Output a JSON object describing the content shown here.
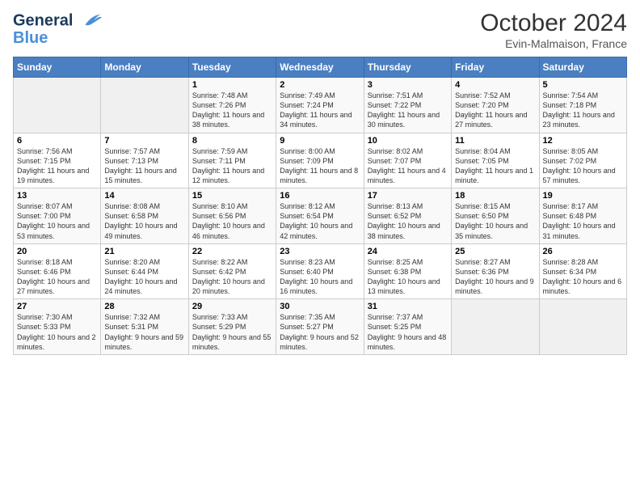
{
  "header": {
    "logo_line1": "General",
    "logo_line2": "Blue",
    "month": "October 2024",
    "location": "Evin-Malmaison, France"
  },
  "days_of_week": [
    "Sunday",
    "Monday",
    "Tuesday",
    "Wednesday",
    "Thursday",
    "Friday",
    "Saturday"
  ],
  "weeks": [
    [
      {
        "day": "",
        "info": ""
      },
      {
        "day": "",
        "info": ""
      },
      {
        "day": "1",
        "info": "Sunrise: 7:48 AM\nSunset: 7:26 PM\nDaylight: 11 hours and 38 minutes."
      },
      {
        "day": "2",
        "info": "Sunrise: 7:49 AM\nSunset: 7:24 PM\nDaylight: 11 hours and 34 minutes."
      },
      {
        "day": "3",
        "info": "Sunrise: 7:51 AM\nSunset: 7:22 PM\nDaylight: 11 hours and 30 minutes."
      },
      {
        "day": "4",
        "info": "Sunrise: 7:52 AM\nSunset: 7:20 PM\nDaylight: 11 hours and 27 minutes."
      },
      {
        "day": "5",
        "info": "Sunrise: 7:54 AM\nSunset: 7:18 PM\nDaylight: 11 hours and 23 minutes."
      }
    ],
    [
      {
        "day": "6",
        "info": "Sunrise: 7:56 AM\nSunset: 7:15 PM\nDaylight: 11 hours and 19 minutes."
      },
      {
        "day": "7",
        "info": "Sunrise: 7:57 AM\nSunset: 7:13 PM\nDaylight: 11 hours and 15 minutes."
      },
      {
        "day": "8",
        "info": "Sunrise: 7:59 AM\nSunset: 7:11 PM\nDaylight: 11 hours and 12 minutes."
      },
      {
        "day": "9",
        "info": "Sunrise: 8:00 AM\nSunset: 7:09 PM\nDaylight: 11 hours and 8 minutes."
      },
      {
        "day": "10",
        "info": "Sunrise: 8:02 AM\nSunset: 7:07 PM\nDaylight: 11 hours and 4 minutes."
      },
      {
        "day": "11",
        "info": "Sunrise: 8:04 AM\nSunset: 7:05 PM\nDaylight: 11 hours and 1 minute."
      },
      {
        "day": "12",
        "info": "Sunrise: 8:05 AM\nSunset: 7:02 PM\nDaylight: 10 hours and 57 minutes."
      }
    ],
    [
      {
        "day": "13",
        "info": "Sunrise: 8:07 AM\nSunset: 7:00 PM\nDaylight: 10 hours and 53 minutes."
      },
      {
        "day": "14",
        "info": "Sunrise: 8:08 AM\nSunset: 6:58 PM\nDaylight: 10 hours and 49 minutes."
      },
      {
        "day": "15",
        "info": "Sunrise: 8:10 AM\nSunset: 6:56 PM\nDaylight: 10 hours and 46 minutes."
      },
      {
        "day": "16",
        "info": "Sunrise: 8:12 AM\nSunset: 6:54 PM\nDaylight: 10 hours and 42 minutes."
      },
      {
        "day": "17",
        "info": "Sunrise: 8:13 AM\nSunset: 6:52 PM\nDaylight: 10 hours and 38 minutes."
      },
      {
        "day": "18",
        "info": "Sunrise: 8:15 AM\nSunset: 6:50 PM\nDaylight: 10 hours and 35 minutes."
      },
      {
        "day": "19",
        "info": "Sunrise: 8:17 AM\nSunset: 6:48 PM\nDaylight: 10 hours and 31 minutes."
      }
    ],
    [
      {
        "day": "20",
        "info": "Sunrise: 8:18 AM\nSunset: 6:46 PM\nDaylight: 10 hours and 27 minutes."
      },
      {
        "day": "21",
        "info": "Sunrise: 8:20 AM\nSunset: 6:44 PM\nDaylight: 10 hours and 24 minutes."
      },
      {
        "day": "22",
        "info": "Sunrise: 8:22 AM\nSunset: 6:42 PM\nDaylight: 10 hours and 20 minutes."
      },
      {
        "day": "23",
        "info": "Sunrise: 8:23 AM\nSunset: 6:40 PM\nDaylight: 10 hours and 16 minutes."
      },
      {
        "day": "24",
        "info": "Sunrise: 8:25 AM\nSunset: 6:38 PM\nDaylight: 10 hours and 13 minutes."
      },
      {
        "day": "25",
        "info": "Sunrise: 8:27 AM\nSunset: 6:36 PM\nDaylight: 10 hours and 9 minutes."
      },
      {
        "day": "26",
        "info": "Sunrise: 8:28 AM\nSunset: 6:34 PM\nDaylight: 10 hours and 6 minutes."
      }
    ],
    [
      {
        "day": "27",
        "info": "Sunrise: 7:30 AM\nSunset: 5:33 PM\nDaylight: 10 hours and 2 minutes."
      },
      {
        "day": "28",
        "info": "Sunrise: 7:32 AM\nSunset: 5:31 PM\nDaylight: 9 hours and 59 minutes."
      },
      {
        "day": "29",
        "info": "Sunrise: 7:33 AM\nSunset: 5:29 PM\nDaylight: 9 hours and 55 minutes."
      },
      {
        "day": "30",
        "info": "Sunrise: 7:35 AM\nSunset: 5:27 PM\nDaylight: 9 hours and 52 minutes."
      },
      {
        "day": "31",
        "info": "Sunrise: 7:37 AM\nSunset: 5:25 PM\nDaylight: 9 hours and 48 minutes."
      },
      {
        "day": "",
        "info": ""
      },
      {
        "day": "",
        "info": ""
      }
    ]
  ]
}
